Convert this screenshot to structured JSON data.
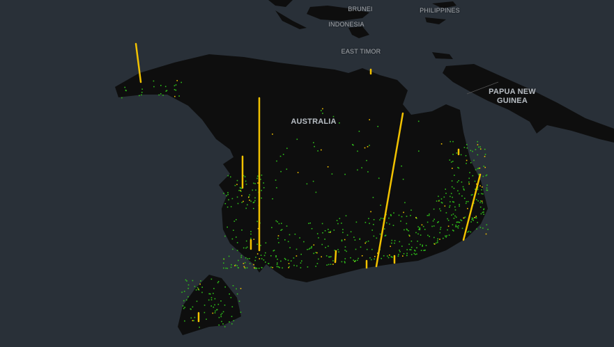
{
  "colors": {
    "water": "#293038",
    "land": "#0e0e0e",
    "bar": "#f2c200",
    "dot": "#2fbf1a"
  },
  "labels": {
    "brunei": "BRUNEI",
    "philippines": "PHILIPPINES",
    "indonesia": "INDONESIA",
    "east_timor": "EAST TIMOR",
    "png_line1": "PAPUA NEW",
    "png_line2": "GUINEA",
    "australia": "AUSTRALIA"
  }
}
